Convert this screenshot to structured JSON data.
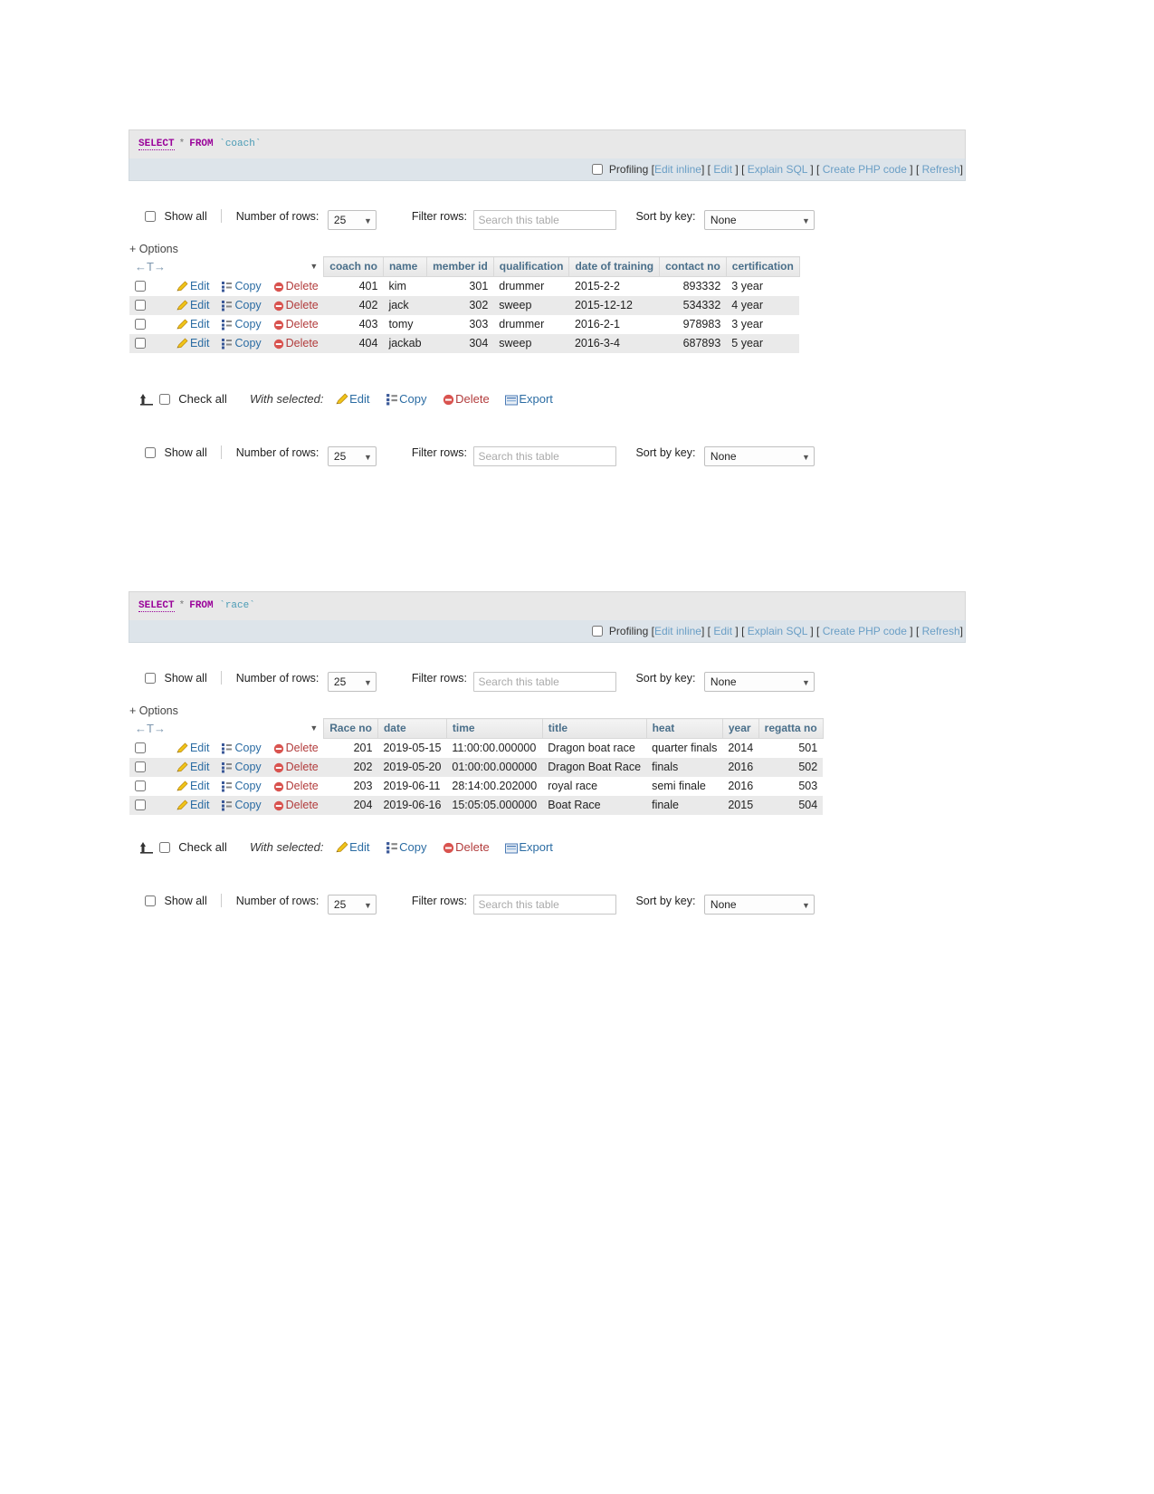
{
  "blocks": [
    {
      "id": "coach",
      "sql": {
        "keyword": "SELECT",
        "star": "*",
        "from": "FROM",
        "table": "`coach`"
      },
      "tools": {
        "profiling_label": "Profiling",
        "edit_inline": "Edit inline",
        "edit": "Edit",
        "explain_sql": "Explain SQL",
        "create_php": "Create PHP code",
        "refresh": "Refresh",
        "open_bracket": "[",
        "close_bracket": "]",
        "pipe": "|"
      },
      "controls": {
        "show_all": "Show all",
        "number_of_rows_label": "Number of rows:",
        "number_of_rows_value": "25",
        "filter_rows_label": "Filter rows:",
        "filter_placeholder": "Search this table",
        "sort_by_key_label": "Sort by key:",
        "sort_by_key_value": "None"
      },
      "options_link": "+ Options",
      "nav_arrows": "←T→",
      "columns": [
        "coach no",
        "name",
        "member id",
        "qualification",
        "date of training",
        "contact no",
        "certification"
      ],
      "row_actions": {
        "edit": "Edit",
        "copy": "Copy",
        "delete": "Delete"
      },
      "rows": [
        {
          "coach_no": "401",
          "name": "kim",
          "member_id": "301",
          "qualification": "drummer",
          "date_of_training": "2015-2-2",
          "contact_no": "893332",
          "certification": "3 year"
        },
        {
          "coach_no": "402",
          "name": "jack",
          "member_id": "302",
          "qualification": "sweep",
          "date_of_training": "2015-12-12",
          "contact_no": "534332",
          "certification": "4 year"
        },
        {
          "coach_no": "403",
          "name": "tomy",
          "member_id": "303",
          "qualification": "drummer",
          "date_of_training": "2016-2-1",
          "contact_no": "978983",
          "certification": "3 year"
        },
        {
          "coach_no": "404",
          "name": "jackab",
          "member_id": "304",
          "qualification": "sweep",
          "date_of_training": "2016-3-4",
          "contact_no": "687893",
          "certification": "5 year"
        }
      ],
      "with_selected": {
        "check_all": "Check all",
        "label": "With selected:",
        "edit": "Edit",
        "copy": "Copy",
        "delete": "Delete",
        "export": "Export"
      }
    },
    {
      "id": "race",
      "sql": {
        "keyword": "SELECT",
        "star": "*",
        "from": "FROM",
        "table": "`race`"
      },
      "tools": {
        "profiling_label": "Profiling",
        "edit_inline": "Edit inline",
        "edit": "Edit",
        "explain_sql": "Explain SQL",
        "create_php": "Create PHP code",
        "refresh": "Refresh",
        "open_bracket": "[",
        "close_bracket": "]",
        "pipe": "|"
      },
      "controls": {
        "show_all": "Show all",
        "number_of_rows_label": "Number of rows:",
        "number_of_rows_value": "25",
        "filter_rows_label": "Filter rows:",
        "filter_placeholder": "Search this table",
        "sort_by_key_label": "Sort by key:",
        "sort_by_key_value": "None"
      },
      "options_link": "+ Options",
      "nav_arrows": "←T→",
      "columns": [
        "Race no",
        "date",
        "time",
        "title",
        "heat",
        "year",
        "regatta no"
      ],
      "row_actions": {
        "edit": "Edit",
        "copy": "Copy",
        "delete": "Delete"
      },
      "rows": [
        {
          "race_no": "201",
          "date": "2019-05-15",
          "time": "11:00:00.000000",
          "title": "Dragon boat race",
          "heat": "quarter finals",
          "year": "2014",
          "regatta_no": "501"
        },
        {
          "race_no": "202",
          "date": "2019-05-20",
          "time": "01:00:00.000000",
          "title": "Dragon Boat Race",
          "heat": "finals",
          "year": "2016",
          "regatta_no": "502"
        },
        {
          "race_no": "203",
          "date": "2019-06-11",
          "time": "28:14:00.202000",
          "title": "royal race",
          "heat": "semi finale",
          "year": "2016",
          "regatta_no": "503"
        },
        {
          "race_no": "204",
          "date": "2019-06-16",
          "time": "15:05:05.000000",
          "title": "Boat Race",
          "heat": "finale",
          "year": "2015",
          "regatta_no": "504"
        }
      ],
      "with_selected": {
        "check_all": "Check all",
        "label": "With selected:",
        "edit": "Edit",
        "copy": "Copy",
        "delete": "Delete",
        "export": "Export"
      }
    }
  ],
  "colors": {
    "link": "#2b6ca3",
    "delete": "#b23c3c",
    "header_text": "#4a6f8a",
    "sql_keyword": "#990099",
    "sql_table": "#4a9bb5",
    "toolbar_link": "#6a9ec5"
  }
}
